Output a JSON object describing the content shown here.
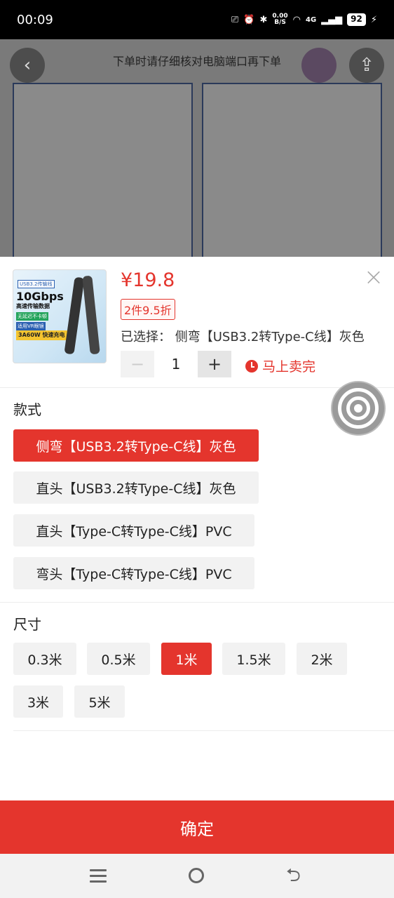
{
  "status_bar": {
    "time": "00:09",
    "net_speed_value": "0.00",
    "net_speed_unit": "B/S",
    "network": "4G",
    "battery": "92"
  },
  "background": {
    "notice": "下单时请仔细核对电脑端口再下单"
  },
  "product": {
    "price": "¥19.8",
    "discount": "2件9.5折",
    "selected_text": "已选择： 侧弯【USB3.2转Type-C线】灰色",
    "quantity": "1",
    "sell_out": "马上卖完",
    "thumb": {
      "tag": "USB3.2传输线",
      "speed": "10Gbps",
      "line1": "高速传输数据",
      "badge1": "无延迟不卡顿",
      "badge2": "适用VR眼镜",
      "power": "3A60W 快速充电"
    }
  },
  "style_section": {
    "title": "款式",
    "options": [
      {
        "label": "侧弯【USB3.2转Type-C线】灰色",
        "selected": true
      },
      {
        "label": "直头【USB3.2转Type-C线】灰色",
        "selected": false
      },
      {
        "label": "直头【Type-C转Type-C线】PVC",
        "selected": false
      },
      {
        "label": "弯头【Type-C转Type-C线】PVC",
        "selected": false
      }
    ]
  },
  "size_section": {
    "title": "尺寸",
    "options": [
      {
        "label": "0.3米",
        "selected": false
      },
      {
        "label": "0.5米",
        "selected": false
      },
      {
        "label": "1米",
        "selected": true
      },
      {
        "label": "1.5米",
        "selected": false
      },
      {
        "label": "2米",
        "selected": false
      },
      {
        "label": "3米",
        "selected": false
      },
      {
        "label": "5米",
        "selected": false
      }
    ]
  },
  "confirm_label": "确定",
  "colors": {
    "accent": "#e4352d",
    "option_bg": "#f2f2f2"
  }
}
